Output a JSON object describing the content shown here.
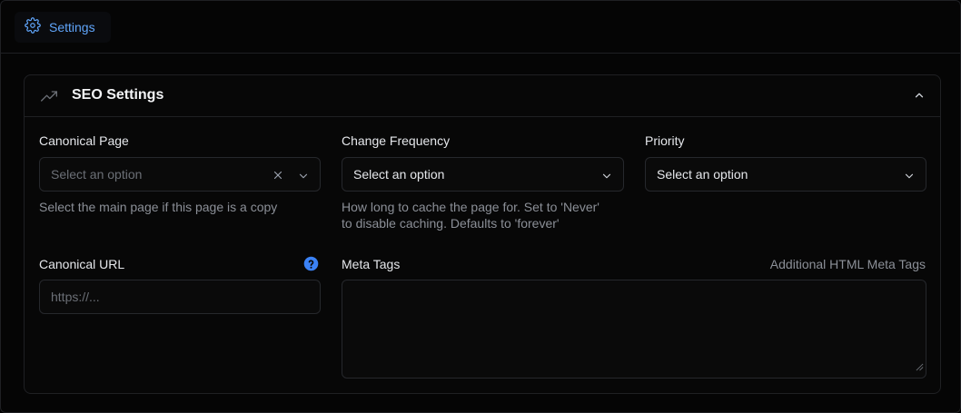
{
  "tabs": [
    {
      "label": "Settings",
      "icon": "gear-icon"
    }
  ],
  "section": {
    "title": "SEO Settings",
    "icon": "trending-up-icon"
  },
  "canonical_page": {
    "label": "Canonical Page",
    "placeholder": "Select an option",
    "hint": "Select the main page if this page is a copy"
  },
  "change_frequency": {
    "label": "Change Frequency",
    "value": "Select an option",
    "hint_line1": "How long to cache the page for. Set to 'Never'",
    "hint_line2": "to disable caching. Defaults to 'forever'"
  },
  "priority": {
    "label": "Priority",
    "value": "Select an option"
  },
  "canonical_url": {
    "label": "Canonical URL",
    "placeholder": "https://..."
  },
  "meta_tags": {
    "label": "Meta Tags",
    "hint": "Additional HTML Meta Tags"
  },
  "colors": {
    "accent": "#60a5fa",
    "help": "#3b82f6"
  }
}
